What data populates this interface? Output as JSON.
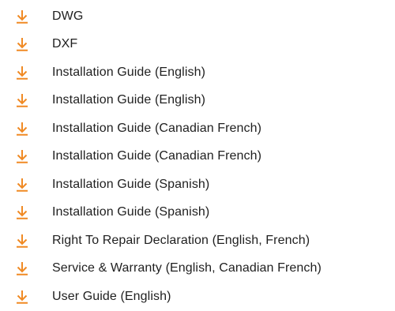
{
  "accent_color": "#f08a24",
  "downloads": {
    "icon": "download-arrow-icon",
    "items": [
      {
        "label": "DWG"
      },
      {
        "label": "DXF"
      },
      {
        "label": "Installation Guide (English)"
      },
      {
        "label": "Installation Guide (English)"
      },
      {
        "label": "Installation Guide (Canadian French)"
      },
      {
        "label": "Installation Guide (Canadian French)"
      },
      {
        "label": "Installation Guide (Spanish)"
      },
      {
        "label": "Installation Guide (Spanish)"
      },
      {
        "label": "Right To Repair Declaration (English, French)"
      },
      {
        "label": "Service & Warranty (English, Canadian French)"
      },
      {
        "label": "User Guide (English)"
      }
    ]
  }
}
